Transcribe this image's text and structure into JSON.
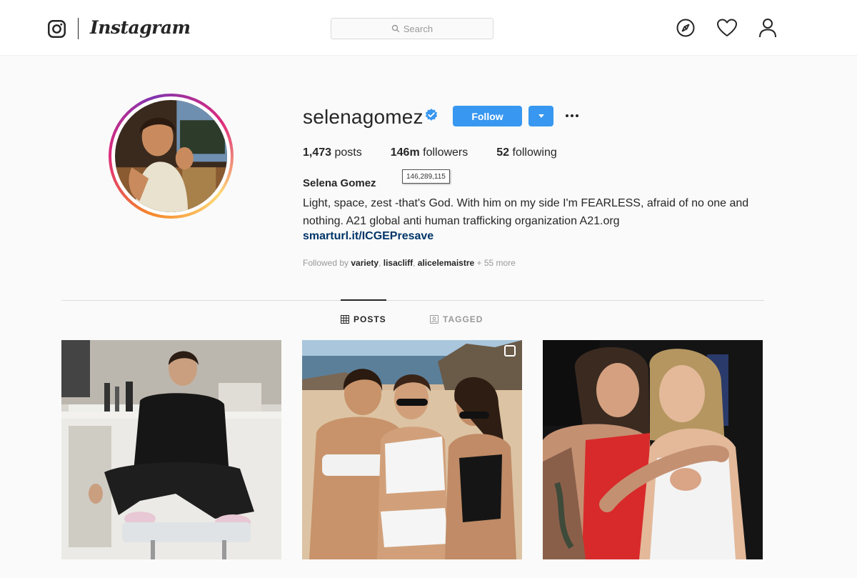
{
  "nav": {
    "brand": "Instagram",
    "search_placeholder": "Search",
    "icons": [
      "instagram-glyph-icon",
      "compass-icon",
      "heart-icon",
      "person-icon"
    ]
  },
  "profile": {
    "username": "selenagomez",
    "verified": true,
    "follow_label": "Follow",
    "stats": {
      "posts_count": "1,473",
      "posts_label": "posts",
      "followers_count": "146m",
      "followers_label": "followers",
      "following_count": "52",
      "following_label": "following"
    },
    "followers_tooltip": "146,289,115",
    "full_name": "Selena Gomez",
    "bio_line1": "Light, space, zest -that's God. With him on my side I'm FEARLESS, afraid of no one and",
    "bio_line2": "nothing. A21 global anti human trafficking organization A21.org",
    "link": "smarturl.it/ICGEPresave",
    "followed_by_prefix": "Followed by",
    "followed_by_users": [
      "variety",
      "lisacliff",
      "alicelemaistre"
    ],
    "followed_by_suffix": "+ 55 more"
  },
  "tabs": [
    {
      "label": "POSTS",
      "active": true
    },
    {
      "label": "TAGGED",
      "active": false
    }
  ],
  "colors": {
    "accent": "#3897f0",
    "link": "#003569",
    "muted": "#999999"
  }
}
